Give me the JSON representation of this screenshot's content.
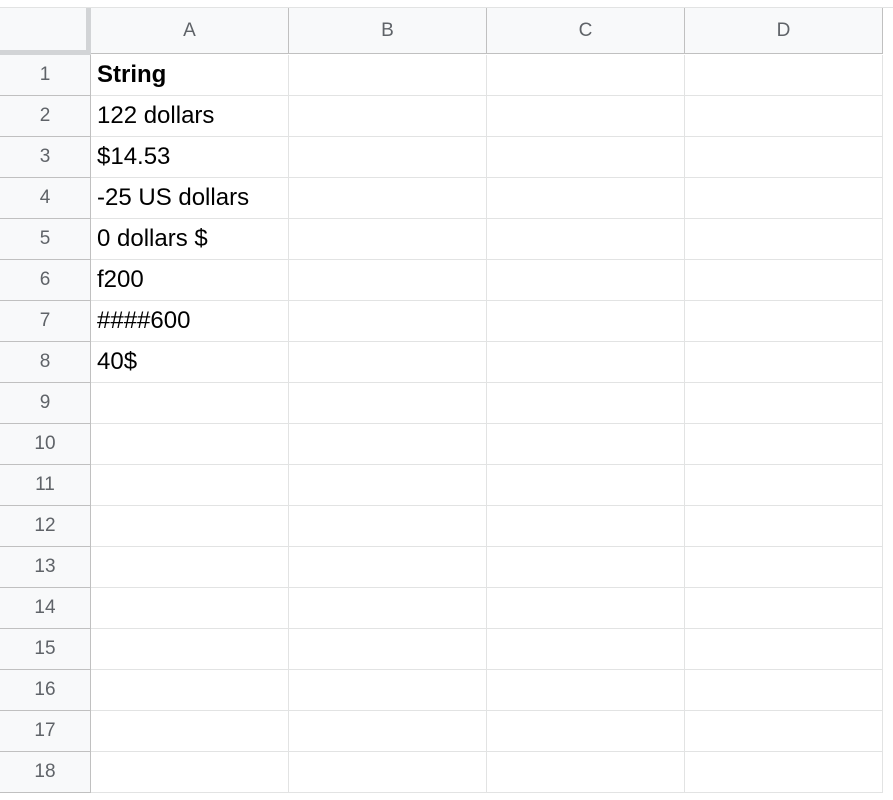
{
  "columns": [
    "A",
    "B",
    "C",
    "D"
  ],
  "rows": [
    {
      "num": "1",
      "cells": [
        "String",
        "",
        "",
        ""
      ],
      "bold": true
    },
    {
      "num": "2",
      "cells": [
        "122 dollars",
        "",
        "",
        ""
      ]
    },
    {
      "num": "3",
      "cells": [
        "$14.53",
        "",
        "",
        ""
      ]
    },
    {
      "num": "4",
      "cells": [
        "-25 US dollars",
        "",
        "",
        ""
      ]
    },
    {
      "num": "5",
      "cells": [
        "0 dollars $",
        "",
        "",
        ""
      ]
    },
    {
      "num": "6",
      "cells": [
        "f200",
        "",
        "",
        ""
      ]
    },
    {
      "num": "7",
      "cells": [
        "####600",
        "",
        "",
        ""
      ]
    },
    {
      "num": "8",
      "cells": [
        "40$",
        "",
        "",
        ""
      ]
    },
    {
      "num": "9",
      "cells": [
        "",
        "",
        "",
        ""
      ]
    },
    {
      "num": "10",
      "cells": [
        "",
        "",
        "",
        ""
      ]
    },
    {
      "num": "11",
      "cells": [
        "",
        "",
        "",
        ""
      ]
    },
    {
      "num": "12",
      "cells": [
        "",
        "",
        "",
        ""
      ]
    },
    {
      "num": "13",
      "cells": [
        "",
        "",
        "",
        ""
      ]
    },
    {
      "num": "14",
      "cells": [
        "",
        "",
        "",
        ""
      ]
    },
    {
      "num": "15",
      "cells": [
        "",
        "",
        "",
        ""
      ]
    },
    {
      "num": "16",
      "cells": [
        "",
        "",
        "",
        ""
      ]
    },
    {
      "num": "17",
      "cells": [
        "",
        "",
        "",
        ""
      ]
    },
    {
      "num": "18",
      "cells": [
        "",
        "",
        "",
        ""
      ]
    }
  ],
  "colors": {
    "header_bg": "#f8f9fa",
    "header_text": "#5f6368",
    "grid_line": "#e2e3e3",
    "header_border": "#c0c0c0"
  }
}
